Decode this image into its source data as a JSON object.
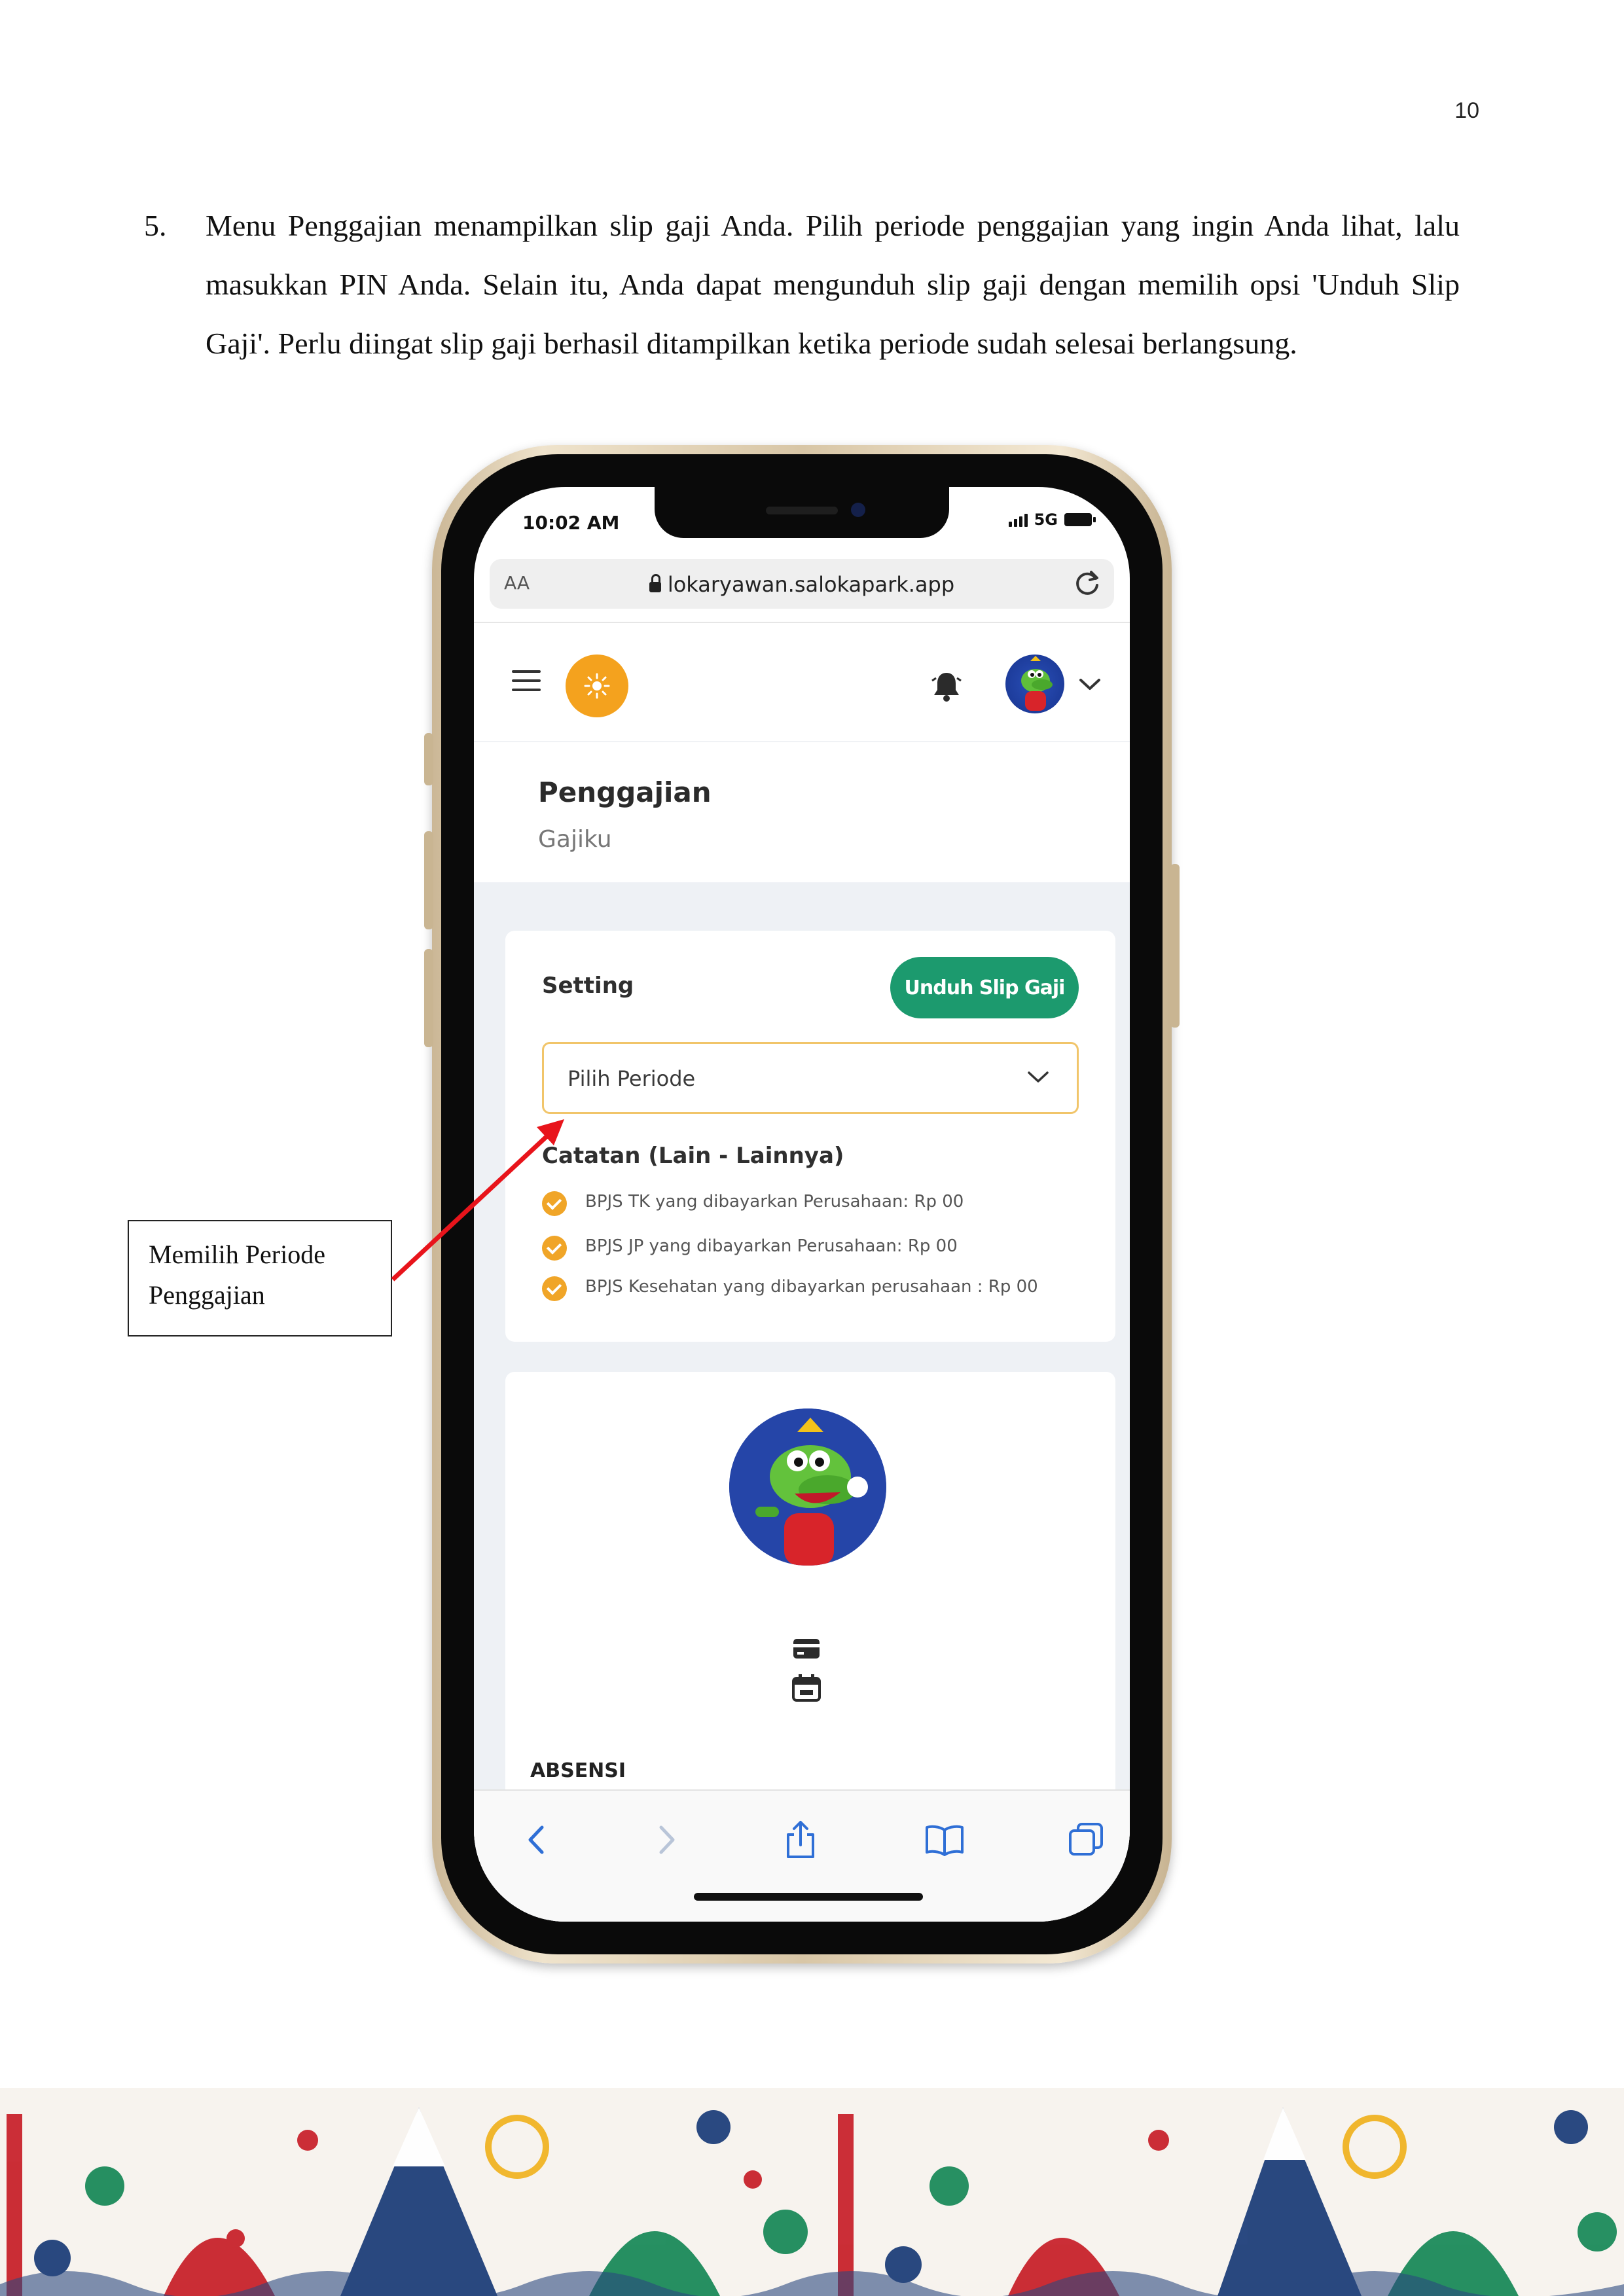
{
  "page": {
    "number": "10",
    "step_number": "5.",
    "step_text": "Menu Penggajian menampilkan slip gaji Anda. Pilih periode penggajian yang ingin Anda lihat, lalu masukkan PIN Anda. Selain itu, Anda dapat mengunduh slip gaji dengan memilih opsi 'Unduh Slip Gaji'. Perlu diingat slip gaji berhasil ditampilkan ketika periode sudah selesai berlangsung.",
    "callout_text": "Memilih Periode Penggajian"
  },
  "phone": {
    "status": {
      "time": "10:02 AM",
      "network": "5G"
    },
    "browser": {
      "text_size": "AA",
      "url": "lokaryawan.salokapark.app"
    },
    "icons": {
      "menu": "hamburger-menu-icon",
      "logo": "sun-logo-icon",
      "notifications": "bell-icon",
      "account": "avatar-mascot",
      "account_menu": "chevron-down-icon"
    },
    "app": {
      "title": "Penggajian",
      "subtitle": "Gajiku",
      "setting_label": "Setting",
      "download_button": "Unduh Slip Gaji",
      "period_select": {
        "selected": "Pilih Periode"
      },
      "notes_title": "Catatan (Lain - Lainnya)",
      "notes": [
        "BPJS TK yang dibayarkan Perusahaan: Rp 00",
        "BPJS JP yang dibayarkan Perusahaan: Rp 00",
        "BPJS Kesehatan yang dibayarkan perusahaan : Rp 00"
      ],
      "section_label": "ABSENSI"
    },
    "toolbar": [
      "back-icon",
      "forward-icon",
      "share-icon",
      "bookmarks-icon",
      "tabs-icon"
    ]
  },
  "colors": {
    "accent_green": "#1c9a6e",
    "logo_orange": "#f4a21e",
    "check_orange": "#f0a528",
    "select_border": "#f1c56a",
    "arrow_red": "#e8141b"
  }
}
